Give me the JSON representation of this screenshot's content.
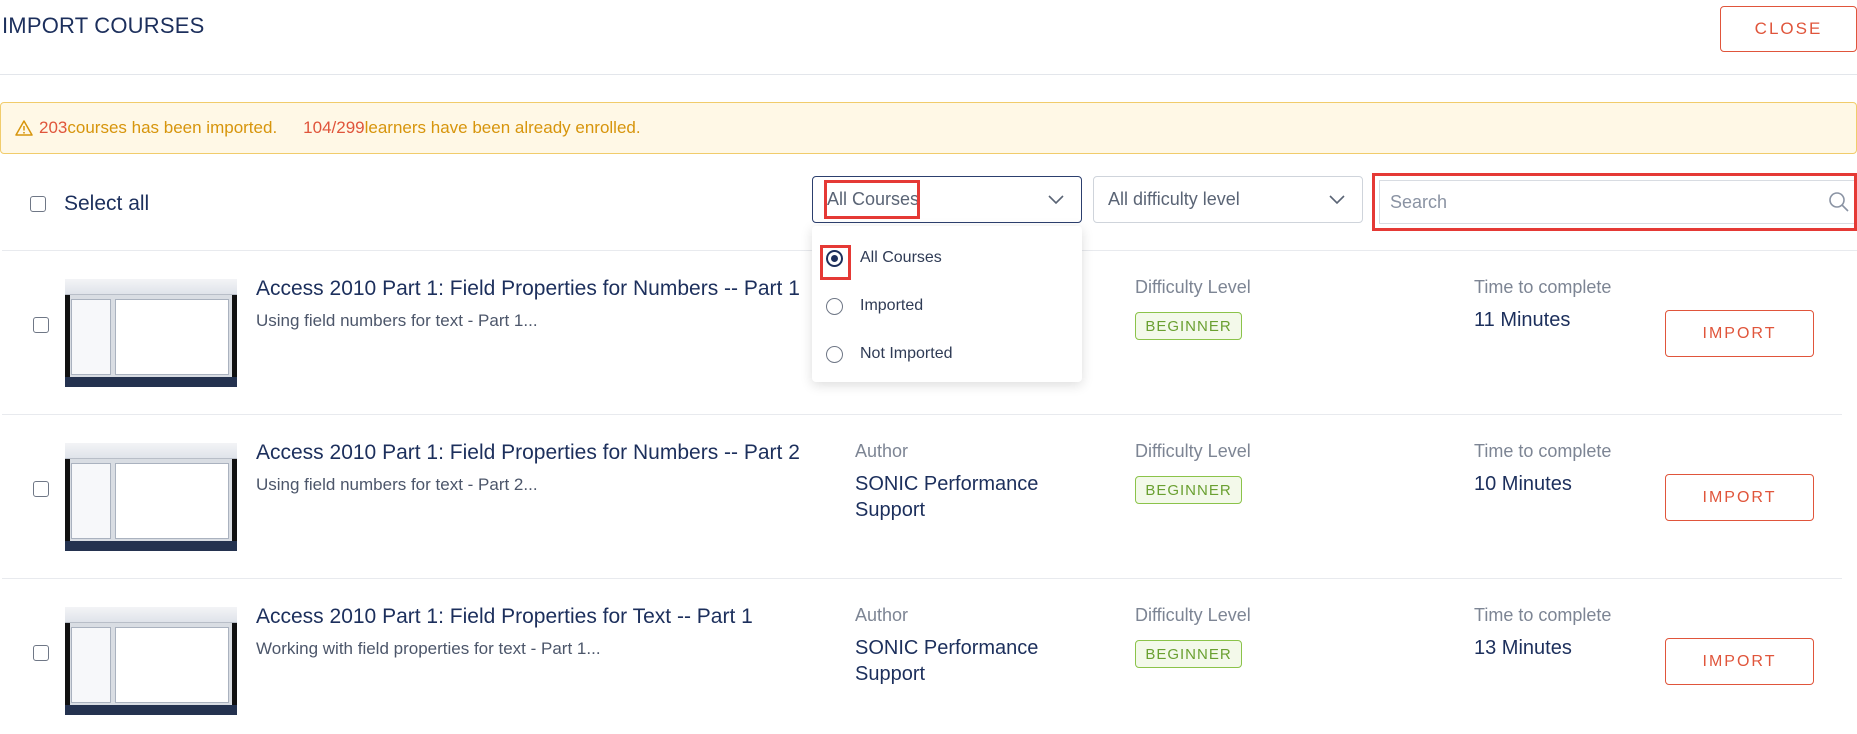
{
  "header": {
    "title": "IMPORT COURSES",
    "close_label": "CLOSE"
  },
  "alert": {
    "imported_count": "203",
    "imported_text": " courses has been imported.",
    "enrolled_count": "104/299",
    "enrolled_text": " learners have been already enrolled.",
    "icon": "warning-icon"
  },
  "toolbar": {
    "select_all_label": "Select all",
    "course_filter_value": "All Courses",
    "difficulty_filter_value": "All difficulty level",
    "search_placeholder": "Search"
  },
  "course_filter_menu": {
    "options": [
      {
        "label": "All Courses",
        "selected": true
      },
      {
        "label": "Imported",
        "selected": false
      },
      {
        "label": "Not Imported",
        "selected": false
      }
    ]
  },
  "courses": [
    {
      "title": "Access 2010 Part 1: Field Properties for Numbers -- Part 1",
      "description": "Using field numbers for text - Part 1...",
      "author_label": "",
      "author": "",
      "difficulty_label": "Difficulty Level",
      "difficulty": "BEGINNER",
      "time_label": "Time to complete",
      "time": "11 Minutes",
      "import_label": "IMPORT"
    },
    {
      "title": "Access 2010 Part 1: Field Properties for Numbers -- Part 2",
      "description": "Using field numbers for text - Part 2...",
      "author_label": "Author",
      "author": "SONIC Performance Support",
      "difficulty_label": "Difficulty Level",
      "difficulty": "BEGINNER",
      "time_label": "Time to complete",
      "time": "10 Minutes",
      "import_label": "IMPORT"
    },
    {
      "title": "Access 2010 Part 1: Field Properties for Text -- Part 1",
      "description": "Working with field properties for text - Part 1...",
      "author_label": "Author",
      "author": "SONIC Performance Support",
      "difficulty_label": "Difficulty Level",
      "difficulty": "BEGINNER",
      "time_label": "Time to complete",
      "time": "13 Minutes",
      "import_label": "IMPORT"
    }
  ],
  "colors": {
    "primary_text": "#1c2f5c",
    "accent": "#e0553b",
    "warning": "#d7950c",
    "beginner_badge": "#6aa031",
    "highlight": "#e53935"
  }
}
